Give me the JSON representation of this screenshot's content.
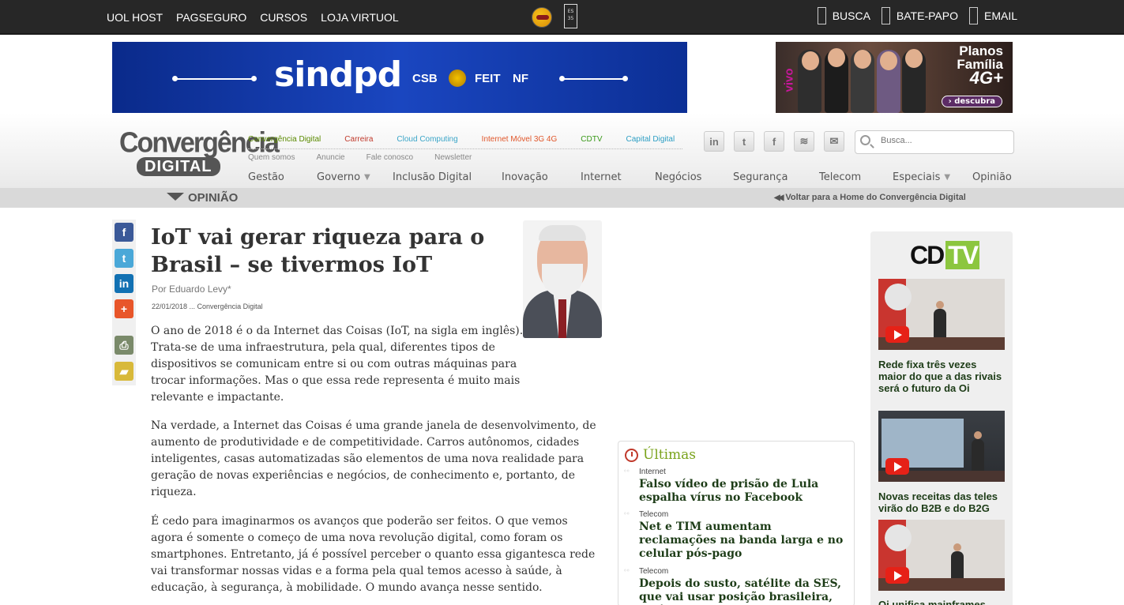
{
  "topbar": {
    "links": [
      "UOL HOST",
      "PAGSEGURO",
      "CURSOS",
      "LOJA VIRTUOL"
    ],
    "right": [
      "BUSCA",
      "BATE-PAPO",
      "EMAIL"
    ]
  },
  "ads": {
    "left": {
      "brand": "sindpd",
      "partners": [
        "CSB",
        "FEIT",
        "NF"
      ]
    },
    "right": {
      "operator": "vivo",
      "line1": "Planos",
      "line2": "Família",
      "line3": "4G+",
      "cta": "descubra"
    }
  },
  "header": {
    "logo_top": "Convergência",
    "logo_bottom": "DIGITAL",
    "sites": [
      {
        "label": "Convergência Digital",
        "color": "#5a8a00"
      },
      {
        "label": "Carreira",
        "color": "#c0392b"
      },
      {
        "label": "Cloud Computing",
        "color": "#3aa5c8"
      },
      {
        "label": "Internet Móvel 3G 4G",
        "color": "#e0562a"
      },
      {
        "label": "CDTV",
        "color": "#3a9a1a"
      },
      {
        "label": "Capital Digital",
        "color": "#2e9fc4"
      }
    ],
    "sublinks": [
      "Quem somos",
      "Anuncie",
      "Fale conosco",
      "Newsletter"
    ],
    "nav": [
      {
        "label": "Gestão",
        "dropdown": false
      },
      {
        "label": "Governo",
        "dropdown": true
      },
      {
        "label": "Inclusão Digital",
        "dropdown": false
      },
      {
        "label": "Inovação",
        "dropdown": false
      },
      {
        "label": "Internet",
        "dropdown": false
      },
      {
        "label": "Negócios",
        "dropdown": false
      },
      {
        "label": "Segurança",
        "dropdown": false
      },
      {
        "label": "Telecom",
        "dropdown": false
      },
      {
        "label": "Especiais",
        "dropdown": true
      },
      {
        "label": "Opinião",
        "dropdown": false
      }
    ],
    "social": [
      "linkedin-icon",
      "twitter-icon",
      "facebook-icon",
      "rss-icon",
      "email-icon"
    ],
    "search_placeholder": "Busca..."
  },
  "section": {
    "title": "OPINIÃO",
    "back_link": "Voltar para a Home do Convergência Digital"
  },
  "share": [
    "facebook-icon",
    "twitter-icon",
    "linkedin-icon",
    "plus-icon",
    "print-icon",
    "folder-icon"
  ],
  "article": {
    "title": "IoT vai gerar riqueza para o Brasil – se tivermos IoT",
    "byline": "Por Eduardo Levy*",
    "date": "22/01/2018 ... Convergência Digital",
    "paragraphs": [
      "O ano de 2018 é o da Internet das Coisas (IoT, na sigla em inglês). Trata-se de uma infraestrutura, pela qual, diferentes tipos de dispositivos se comunicam entre si ou com outras máquinas para trocar informações. Mas o que essa rede representa é muito mais relevante e impactante.",
      "Na verdade, a Internet das Coisas é uma grande janela de desenvolvimento, de aumento de produtividade e de competitividade. Carros autônomos, cidades inteligentes, casas automatizadas são elementos de uma nova realidade para geração de novas experiências e negócios, de conhecimento e, portanto, de riqueza.",
      "É cedo para imaginarmos os avanços que poderão ser feitos. O que vemos agora é somente o começo de uma nova revolução digital, como foram os smartphones. Entretanto, já é possível perceber o quanto essa gigantesca rede vai transformar nossas vidas e a forma pela qual temos acesso à saúde, à educação, à segurança, à mobilidade. O mundo avança nesse sentido."
    ]
  },
  "ultimas": {
    "heading": "Últimas",
    "items": [
      {
        "category": "Internet",
        "headline": "Falso vídeo de prisão de Lula espalha vírus no Facebook"
      },
      {
        "category": "Telecom",
        "headline": "Net e TIM aumentam reclamações na banda larga e no celular pós-pago"
      },
      {
        "category": "Telecom",
        "headline": "Depois do susto, satélite da SES, que vai usar posição brasileira, está em"
      }
    ]
  },
  "cdtv": {
    "logo_a": "CD",
    "logo_b": "TV",
    "videos": [
      {
        "caption": "Rede fixa três vezes maior do que a das rivais será o futuro da Oi"
      },
      {
        "caption": "Novas receitas das teles virão do B2B e do B2G"
      },
      {
        "caption": "Oi unifica mainframes"
      }
    ]
  }
}
